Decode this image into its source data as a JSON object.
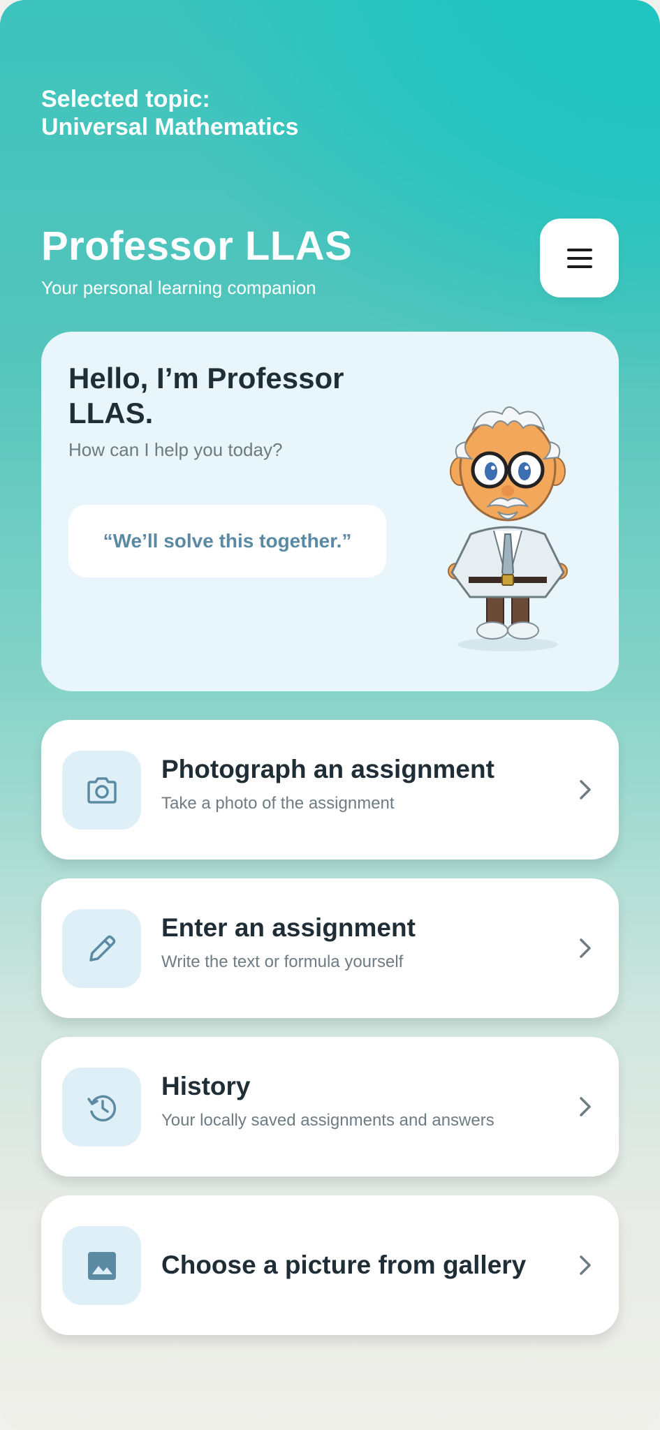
{
  "header": {
    "topic_label": "Selected topic: Universal Mathematics",
    "app_title": "Professor LLAS",
    "app_subtitle": "Your personal learning companion",
    "menu_icon": "hamburger-menu-icon"
  },
  "hero": {
    "greeting": "Hello, I’m Professor LLAS.",
    "question": "How can I help you today?",
    "quote": "“We’ll solve this together.”",
    "mascot_icon": "professor-mascot"
  },
  "actions": [
    {
      "icon": "camera-icon",
      "title": "Photograph an assignment",
      "description": "Take a photo of the assignment"
    },
    {
      "icon": "pencil-icon",
      "title": "Enter an assignment",
      "description": "Write the text or formula yourself"
    },
    {
      "icon": "history-icon",
      "title": "History",
      "description": "Your locally saved assignments and answers"
    },
    {
      "icon": "image-icon",
      "title": "Choose a picture from gallery",
      "description": ""
    }
  ],
  "colors": {
    "accent_teal": "#1fc4c0",
    "icon_blue": "#5b8aa3",
    "icon_box": "#deeff7",
    "hero_bg": "#e8f6fb",
    "text_dark": "#1f2d36"
  }
}
